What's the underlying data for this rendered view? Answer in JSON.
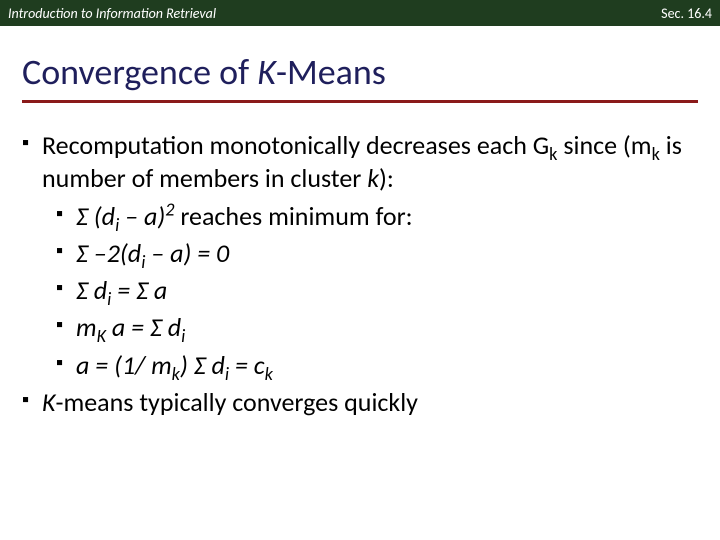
{
  "topbar": {
    "left": "Introduction to Information Retrieval",
    "right": "Sec. 16.4"
  },
  "title": {
    "prefix": "Convergence of ",
    "k": "K",
    "suffix": "-Means"
  },
  "bullets": {
    "b1a": "Recomputation monotonically decreases each G",
    "b1a_sub": "k",
    "b1b_pre": " since (m",
    "b1b_sub": "k",
    "b1b_post": " is number of members in cluster ",
    "b1b_kital": "k",
    "b1b_end": "):",
    "s1_pre": "Σ (d",
    "s1_sub": "i",
    "s1_mid": " – a)",
    "s1_sup": "2",
    "s1_post": " reaches minimum for:",
    "s2_pre": "Σ –2(d",
    "s2_sub": "i",
    "s2_post": " – a) = 0",
    "s3_pre": "Σ d",
    "s3_sub": "i",
    "s3_post": " = Σ a",
    "s4_pre": "m",
    "s4_sub": "K",
    "s4_mid": " a = Σ d",
    "s4_sub2": "i",
    "s5_pre": "a = (1/ m",
    "s5_sub": "k",
    "s5_mid": ") Σ d",
    "s5_sub2": "i",
    "s5_mid2": " = c",
    "s5_sub3": "k",
    "b2_k": "K",
    "b2_rest": "-means typically converges quickly"
  },
  "glyph": "▪"
}
